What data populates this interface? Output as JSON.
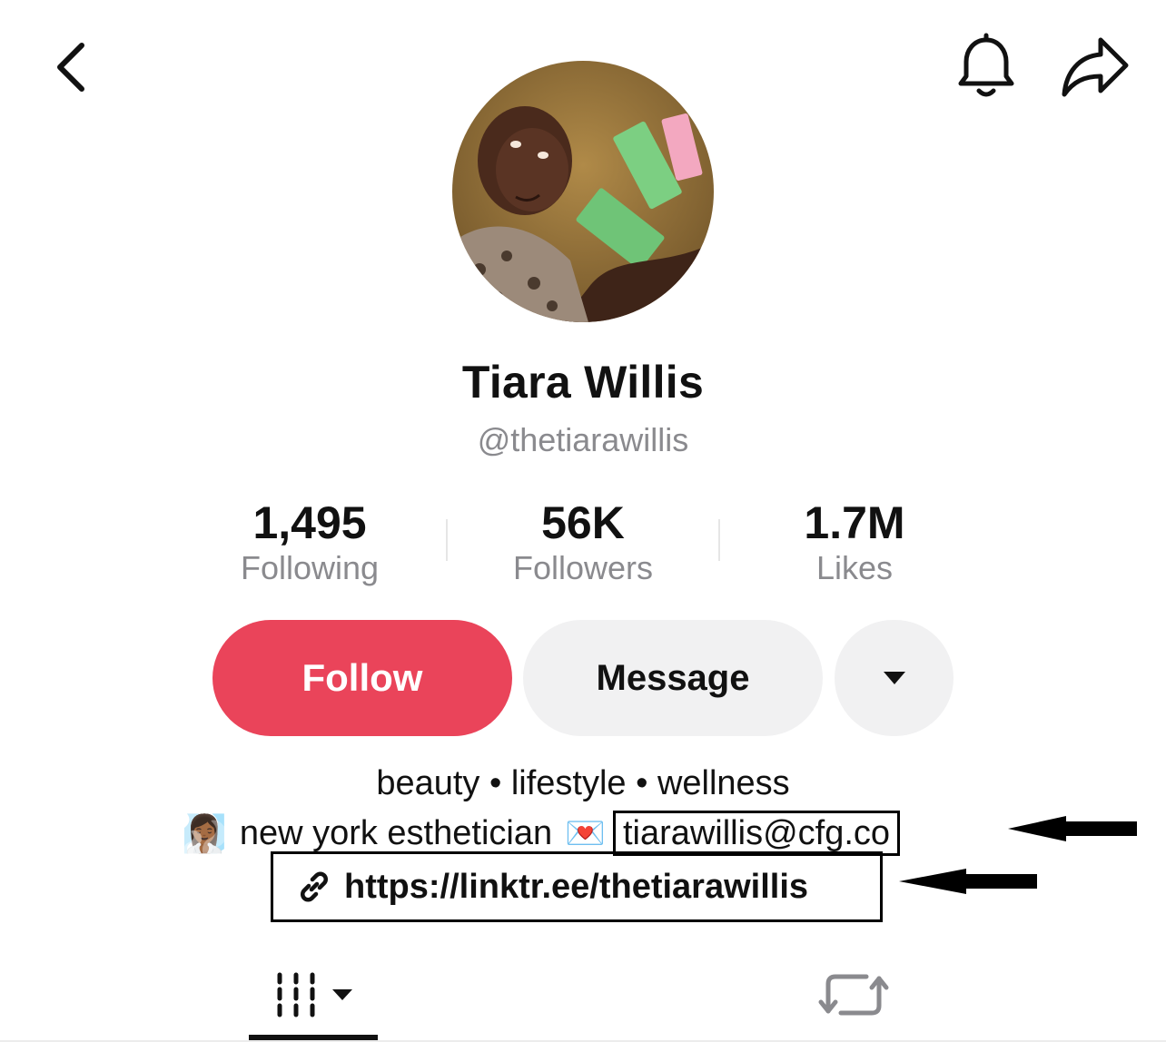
{
  "header": {
    "back_icon": "chevron-left-icon",
    "notify_icon": "bell-icon",
    "share_icon": "share-arrow-icon"
  },
  "profile": {
    "display_name": "Tiara Willis",
    "username": "@thetiarawillis",
    "avatar_icon": "profile-photo"
  },
  "stats": [
    {
      "value": "1,495",
      "label": "Following"
    },
    {
      "value": "56K",
      "label": "Followers"
    },
    {
      "value": "1.7M",
      "label": "Likes"
    }
  ],
  "actions": {
    "follow_label": "Follow",
    "message_label": "Message",
    "more_icon": "caret-down-icon",
    "follow_color": "#ea445a"
  },
  "bio": {
    "line1": "beauty • lifestyle • wellness",
    "line2_text": "new york esthetician",
    "line2_emoji_person": "🧖🏾‍♀️",
    "line2_emoji_mail": "💌",
    "email": "tiarawillis@cfg.co",
    "link": "https://linktr.ee/thetiarawillis",
    "link_icon": "link-icon"
  },
  "tabs": [
    {
      "name": "videos",
      "icon": "grid-icon"
    },
    {
      "name": "reposts",
      "icon": "repost-icon"
    }
  ]
}
